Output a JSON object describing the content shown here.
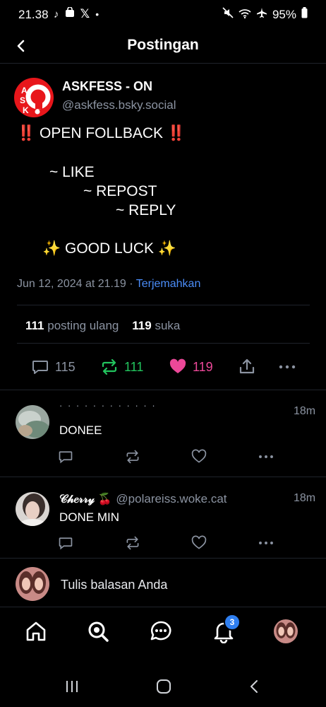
{
  "status_bar": {
    "time": "21.38",
    "battery": "95%"
  },
  "header": {
    "title": "Postingan"
  },
  "post": {
    "author_name": "ASKFESS - ON",
    "author_handle": "@askfess.bsky.social",
    "avatar_text": "ASK",
    "lines": [
      "‼️ OPEN FOLLBACK ‼️",
      "~ LIKE",
      "~ REPOST",
      "~ REPLY",
      "✨ GOOD LUCK ✨"
    ],
    "timestamp": "Jun 12, 2024 at 21.19",
    "separator": "·",
    "translate_label": "Terjemahkan",
    "repost_count": "111",
    "repost_label": "posting ulang",
    "like_count": "119",
    "like_label": "suka",
    "reply_action_count": "115",
    "repost_action_count": "111",
    "like_action_count": "119"
  },
  "replies": [
    {
      "name_cut": "· · · · · · · · · · · ·",
      "time": "18m",
      "text": "DONEE"
    },
    {
      "name": "𝒞𝒽𝑒𝓇𝓇𝓎 🍒",
      "handle": "@polareiss.woke.cat",
      "time": "18m",
      "text": "DONE MIN"
    }
  ],
  "composer": {
    "placeholder": "Tulis balasan Anda"
  },
  "tab_bar": {
    "notifications_badge": "3"
  },
  "colors": {
    "accent": "#4b8df8",
    "like": "#ec4899",
    "repost": "#22c55e",
    "muted": "#8b93a1",
    "logo_red": "#e8161b"
  }
}
